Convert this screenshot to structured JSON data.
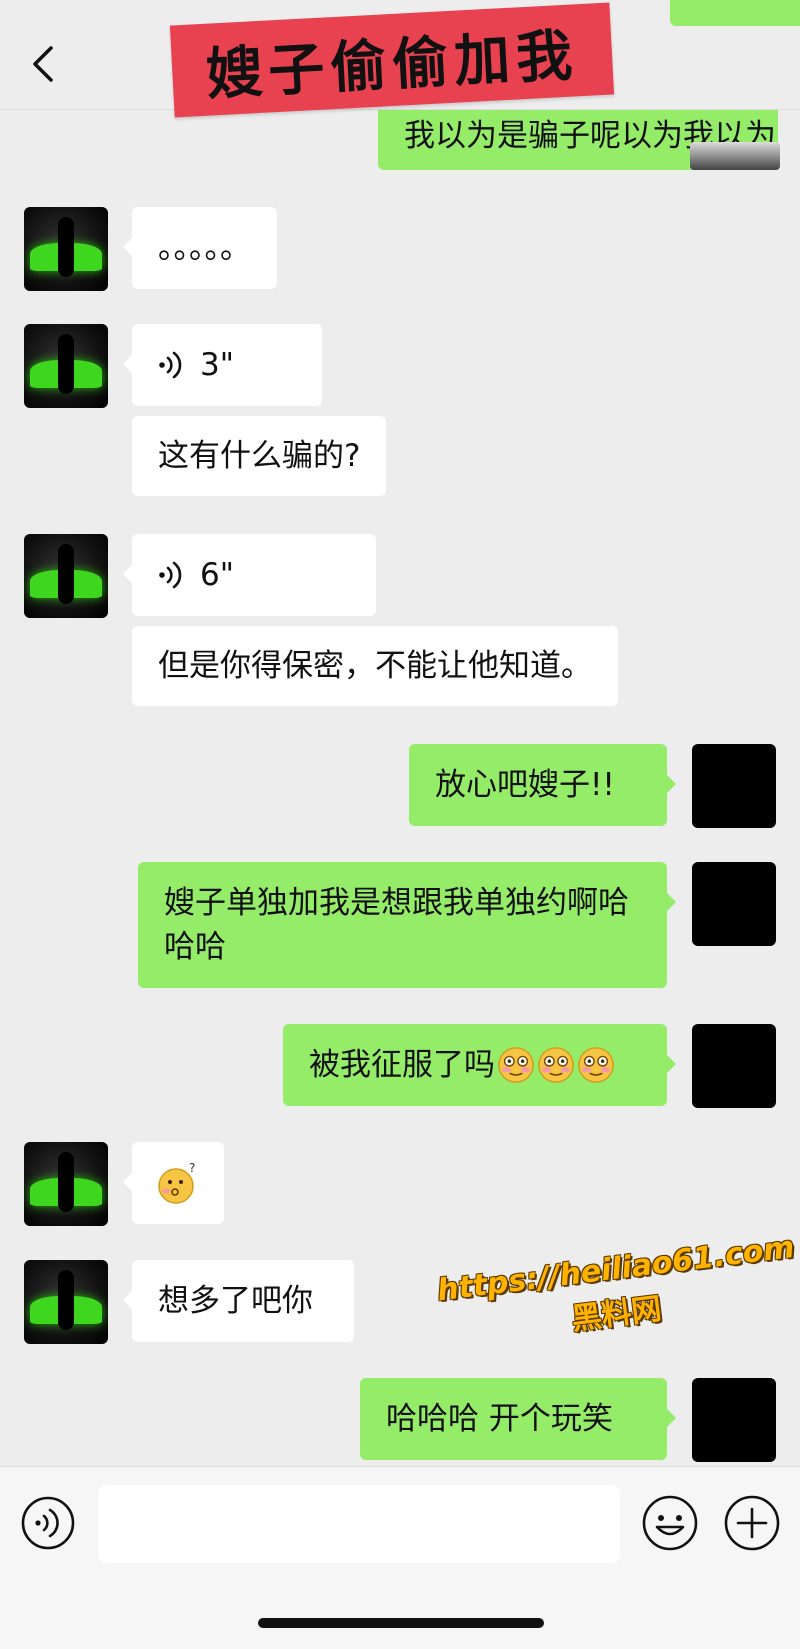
{
  "header": {
    "title_banner": "嫂子偷偷加我",
    "back_icon": "chevron-left-icon"
  },
  "messages": [
    {
      "side": "right",
      "type": "text",
      "text": "我以为是骗子呢以为我以为",
      "partial": true
    },
    {
      "side": "left",
      "type": "text",
      "text": "。。。。。"
    },
    {
      "side": "left",
      "type": "voice",
      "duration": "3\""
    },
    {
      "side": "left",
      "type": "text",
      "text": "这有什么骗的?"
    },
    {
      "side": "left",
      "type": "voice",
      "duration": "6\""
    },
    {
      "side": "left",
      "type": "text",
      "text": "但是你得保密，不能让他知道。"
    },
    {
      "side": "right",
      "type": "text",
      "text": "放心吧嫂子!!"
    },
    {
      "side": "right",
      "type": "text",
      "text": "嫂子单独加我是想跟我单独约啊哈哈哈"
    },
    {
      "side": "right",
      "type": "text",
      "text": "被我征服了吗",
      "emojis": [
        "flushed-icon",
        "flushed-icon",
        "flushed-icon"
      ]
    },
    {
      "side": "left",
      "type": "emoji",
      "emoji": "confused-icon"
    },
    {
      "side": "left",
      "type": "text",
      "text": "想多了吧你"
    },
    {
      "side": "right",
      "type": "text",
      "text": "哈哈哈 开个玩笑"
    }
  ],
  "watermark": {
    "url": "https://heiliao61.com",
    "name": "黑料网"
  },
  "input_bar": {
    "value": "",
    "voice_icon": "voice-input-icon",
    "emoji_icon": "smiley-icon",
    "plus_icon": "plus-circle-icon"
  },
  "colors": {
    "background": "#ededed",
    "bubble_sent": "#95ec69",
    "bubble_received": "#ffffff",
    "banner": "#e8414f",
    "watermark": "#ffb300"
  }
}
